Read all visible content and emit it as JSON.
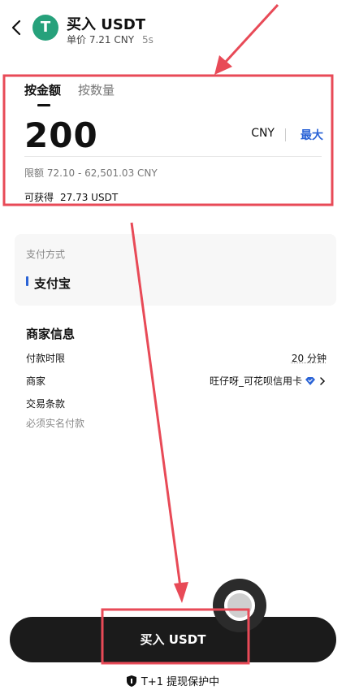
{
  "header": {
    "title": "买入 USDT",
    "unit_price": "单价 7.21 CNY",
    "timer": "5s",
    "coin_symbol": "T",
    "coin_color": "#26a17b"
  },
  "amount": {
    "tabs": [
      "按金额",
      "按数量"
    ],
    "value": "200",
    "currency": "CNY",
    "max_label": "最大",
    "limit": "限额 72.10 - 62,501.03 CNY",
    "receive_label": "可获得",
    "receive_value": "27.73 USDT"
  },
  "payment": {
    "label": "支付方式",
    "method": "支付宝"
  },
  "merchant": {
    "title": "商家信息",
    "rows": [
      {
        "label": "付款时限",
        "value": "20 分钟"
      },
      {
        "label": "商家",
        "value": "旺仔呀_可花呗信用卡"
      }
    ],
    "terms_label": "交易条款",
    "terms_text": "必须实名付款"
  },
  "buy_button": "买入 USDT",
  "protection": "T+1 提现保护中",
  "colors": {
    "accent_blue": "#2a63d6",
    "button_bg": "#1b1b1b",
    "annotation_red": "#e84a57"
  }
}
